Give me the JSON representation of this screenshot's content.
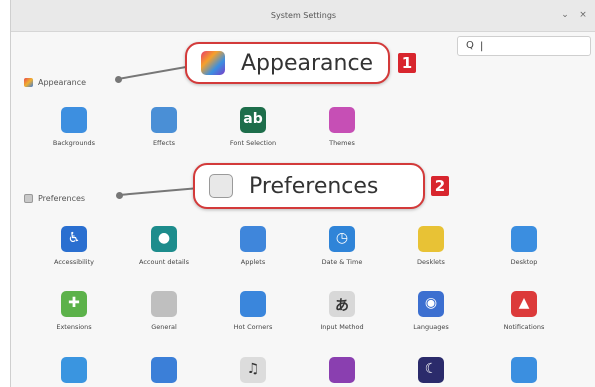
{
  "window": {
    "title": "System Settings",
    "minimize_glyph": "⌄",
    "close_glyph": "×"
  },
  "search": {
    "icon": "search-icon",
    "glyph": "Q",
    "caret": "|"
  },
  "sections": {
    "appearance": {
      "label": "Appearance",
      "icon": "appearance-icon"
    },
    "preferences": {
      "label": "Preferences",
      "icon": "preferences-icon"
    }
  },
  "callouts": {
    "appearance": {
      "text": "Appearance",
      "badge": "1"
    },
    "preferences": {
      "text": "Preferences",
      "badge": "2"
    }
  },
  "appearance_items": [
    {
      "label": "Backgrounds",
      "icon": "backgrounds-icon",
      "color": "#3d8fe0"
    },
    {
      "label": "Effects",
      "icon": "effects-icon",
      "color": "#4a8fd6"
    },
    {
      "label": "Font Selection",
      "icon": "font-selection-icon",
      "color": "#1e6e4b",
      "glyph": "ab"
    },
    {
      "label": "Themes",
      "icon": "themes-icon",
      "color": "#c64fb5"
    }
  ],
  "preferences_row1": [
    {
      "label": "Accessibility",
      "icon": "accessibility-icon",
      "color": "#2a6fd0",
      "glyph": "♿"
    },
    {
      "label": "Account details",
      "icon": "account-details-icon",
      "color": "#1d8c8c",
      "glyph": "●"
    },
    {
      "label": "Applets",
      "icon": "applets-icon",
      "color": "#3f86db"
    },
    {
      "label": "Date & Time",
      "icon": "date-time-icon",
      "color": "#2f84d8",
      "glyph": "◷"
    },
    {
      "label": "Desklets",
      "icon": "desklets-icon",
      "color": "#e8c235"
    },
    {
      "label": "Desktop",
      "icon": "desktop-icon",
      "color": "#3b8ee0"
    }
  ],
  "preferences_row2": [
    {
      "label": "Extensions",
      "icon": "extensions-icon",
      "color": "#5cb24a",
      "glyph": "✚"
    },
    {
      "label": "General",
      "icon": "general-icon",
      "color": "#bfbfbf"
    },
    {
      "label": "Hot Corners",
      "icon": "hot-corners-icon",
      "color": "#3a86dc"
    },
    {
      "label": "Input Method",
      "icon": "input-method-icon",
      "color": "#d8d8d8",
      "glyph": "あ"
    },
    {
      "label": "Languages",
      "icon": "languages-icon",
      "color": "#3c6fd0",
      "glyph": "◉"
    },
    {
      "label": "Notifications",
      "icon": "notifications-icon",
      "color": "#dc3a3a",
      "glyph": "▲"
    }
  ],
  "preferences_row3": [
    {
      "icon": "online-accounts-icon",
      "color": "#3a95e0"
    },
    {
      "icon": "panel-icon",
      "color": "#3b7fd8"
    },
    {
      "icon": "sound-icon",
      "color": "#dcdcdc",
      "glyph": "♫"
    },
    {
      "icon": "privacy-icon",
      "color": "#8a3fb0"
    },
    {
      "icon": "screensaver-icon",
      "color": "#2b2b6b",
      "glyph": "☾"
    },
    {
      "icon": "windows-icon",
      "color": "#3b8fe0"
    }
  ]
}
